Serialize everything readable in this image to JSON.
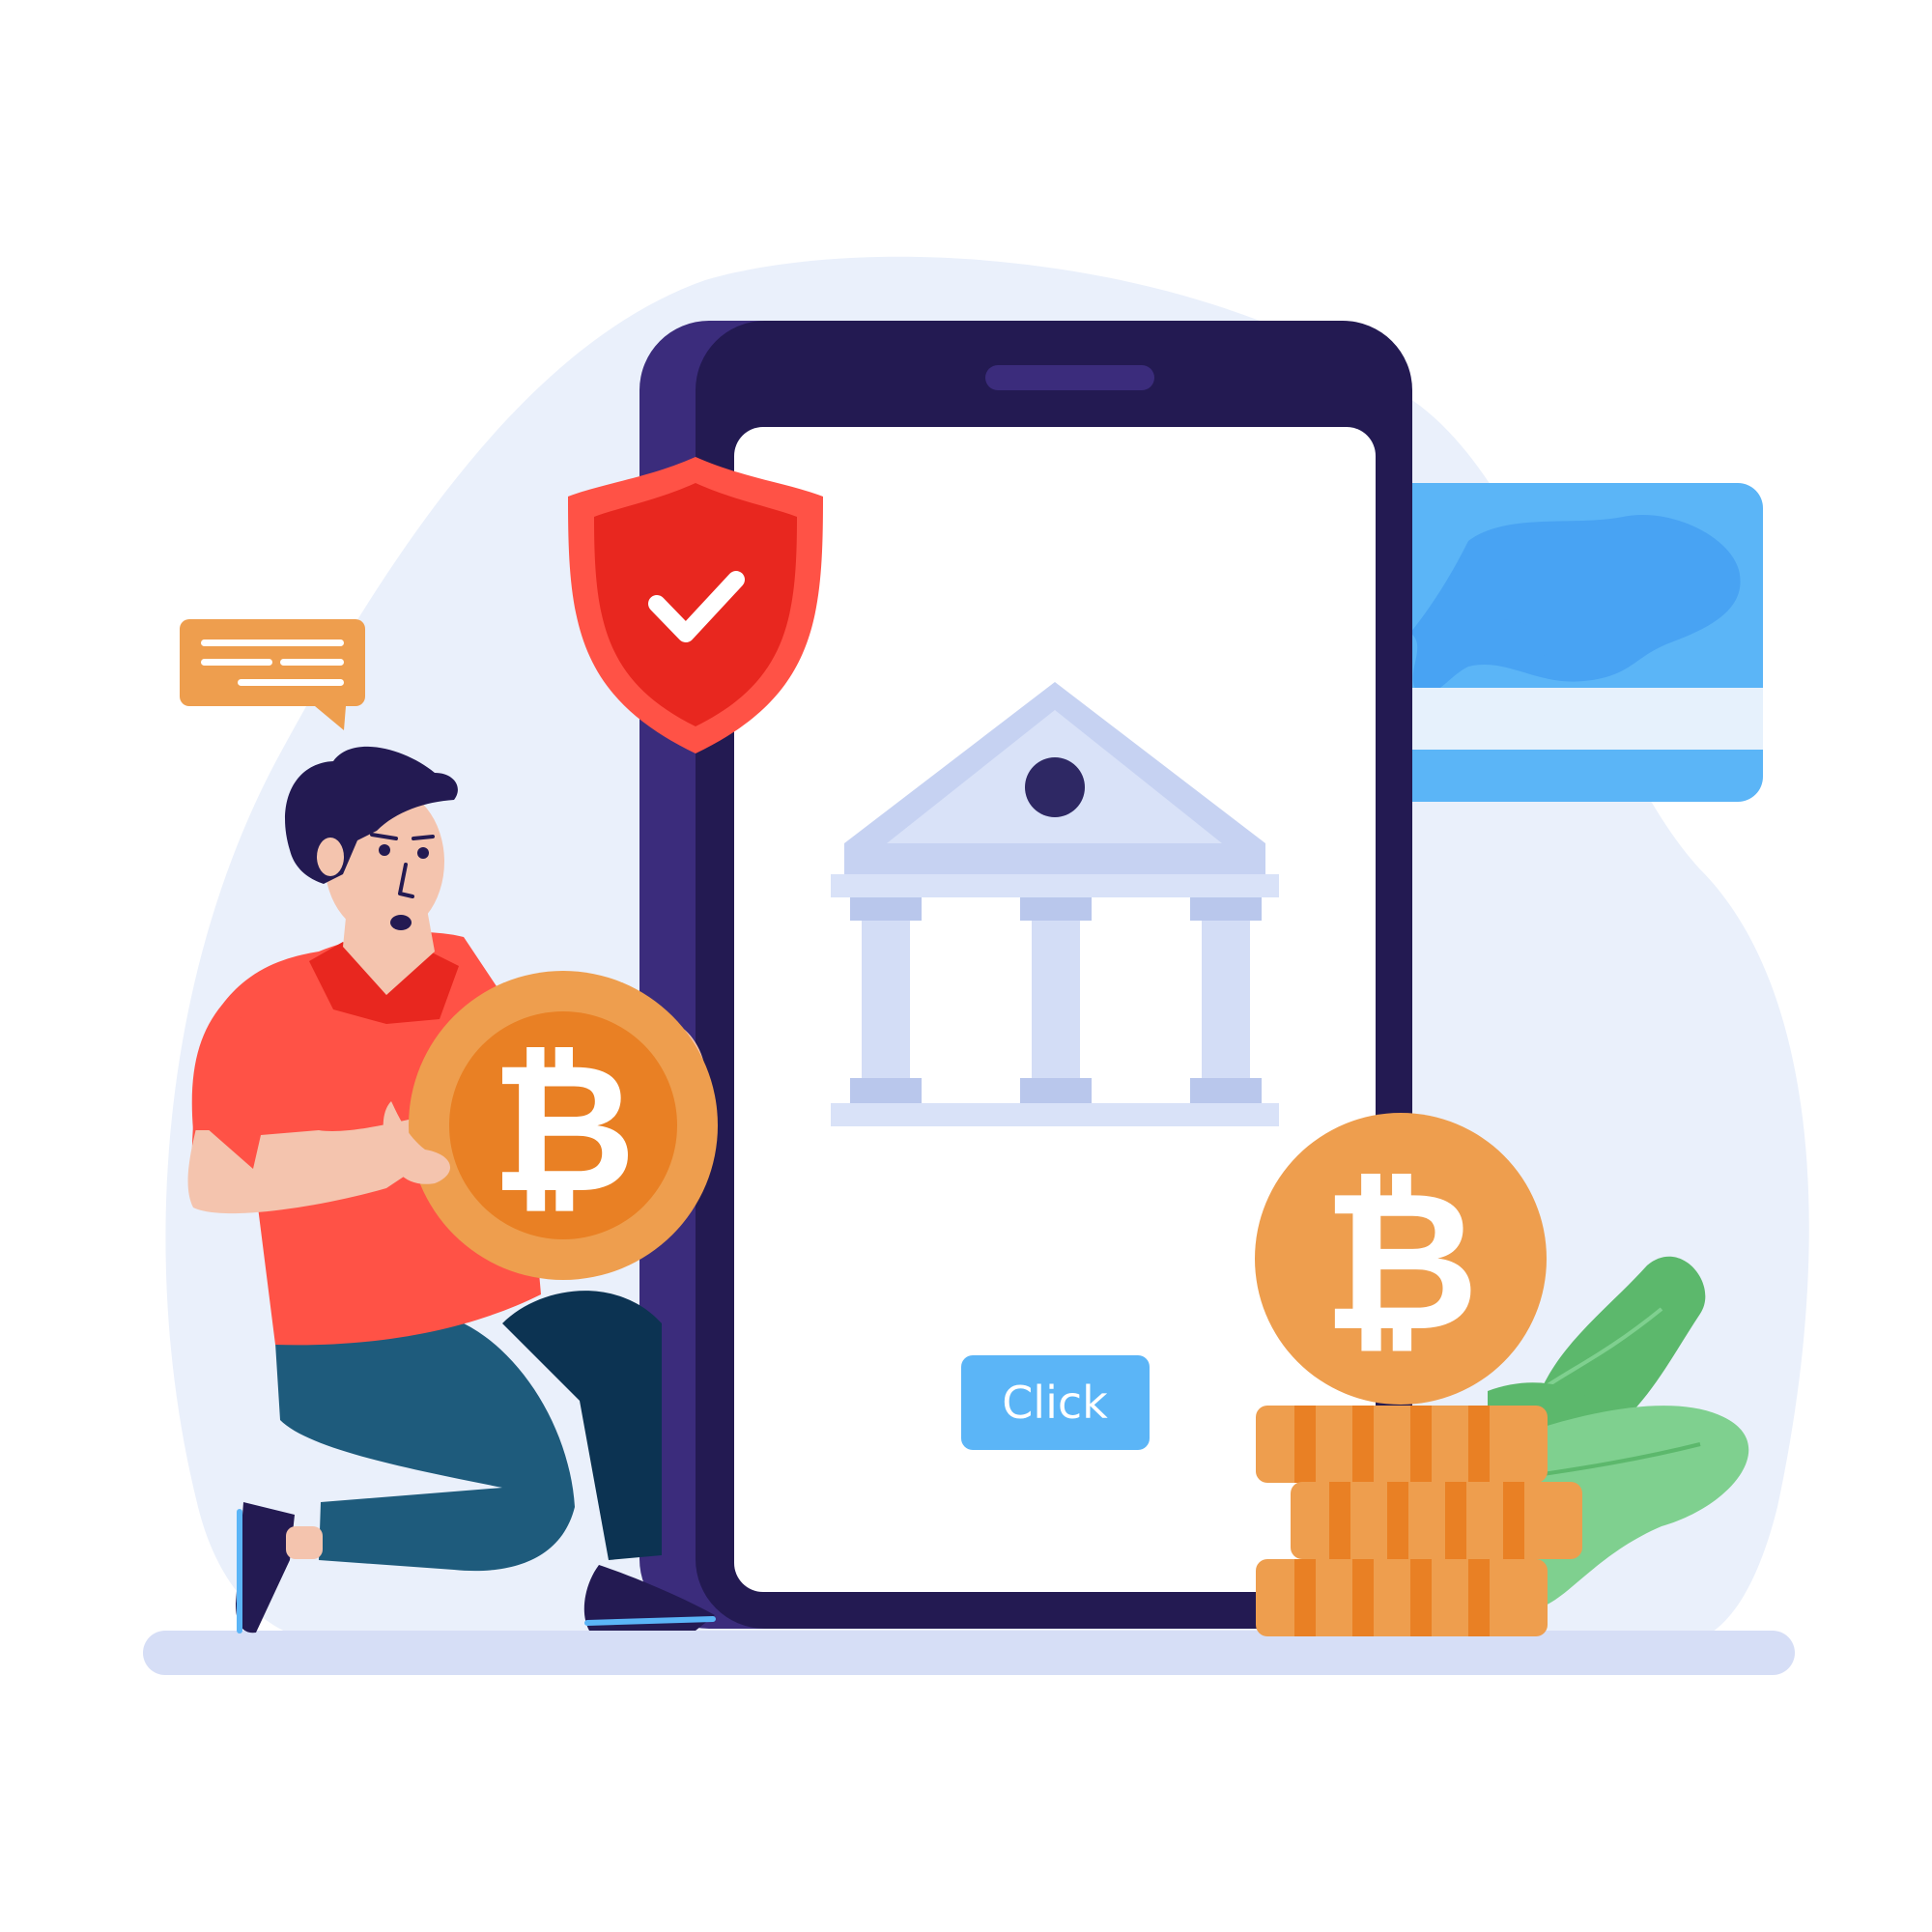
{
  "phone": {
    "button_label": "Click"
  },
  "coins": {
    "symbol": "₿"
  },
  "colors": {
    "background_blob": "#eaf0fb",
    "phone_frame": "#231a52",
    "phone_frame_side": "#3b2c7c",
    "screen": "#ffffff",
    "shield_outer": "#ff5246",
    "shield_inner": "#e8271f",
    "bank": "#d3ddf6",
    "bank_dark": "#b9c7ec",
    "bank_dot": "#2e2864",
    "button": "#5bb5f7",
    "card": "#5bb5f7",
    "card_map": "#48a3f3",
    "card_stripe": "#e6f1fc",
    "chat_bubble": "#ee9e4e",
    "coin": "#ee9e4e",
    "coin_inner": "#e98024",
    "leaf_dark": "#5cb86c",
    "leaf_light": "#7fd08f",
    "shirt": "#ff5246",
    "collar": "#e8271f",
    "pants_light": "#1e5b7c",
    "pants_dark": "#0c3352",
    "hair": "#231a52",
    "skin": "#f4c4ae",
    "ground": "#d6def6"
  },
  "icons": [
    "shield-check-icon",
    "bank-icon",
    "bitcoin-icon",
    "credit-card-icon",
    "chat-bubble-icon",
    "leaf-icon"
  ]
}
